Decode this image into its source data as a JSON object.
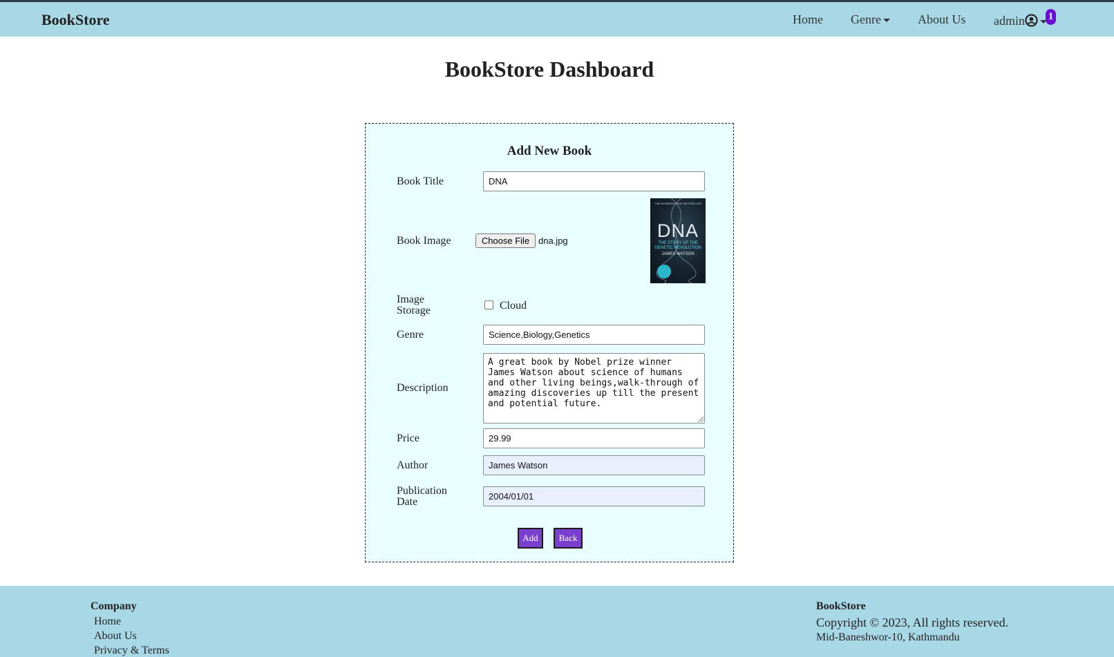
{
  "nav": {
    "brand": "BookStore",
    "links": {
      "home": "Home",
      "genre": "Genre",
      "about": "About Us",
      "user": "admin"
    },
    "notification_count": "1"
  },
  "page": {
    "title": "BookStore Dashboard"
  },
  "form": {
    "heading": "Add New Book",
    "labels": {
      "title": "Book Title",
      "image": "Book Image",
      "storage": "Image Storage",
      "genre": "Genre",
      "description": "Description",
      "price": "Price",
      "author": "Author",
      "date": "Publication Date"
    },
    "values": {
      "title": "DNA",
      "file_button": "Choose File",
      "file_name": "dna.jpg",
      "storage_option": "Cloud",
      "storage_checked": false,
      "genre": "Science,Biology,Genetics",
      "description": "A great book by Nobel prize winner James Watson about science of humans and other living beings,walk-through of amazing discoveries up till the present and potential future.",
      "price": "29.99",
      "author": "James Watson",
      "date": "2004/01/01"
    },
    "cover": {
      "top": "THE INTERNATIONAL BESTSELLER",
      "title": "DNA",
      "subtitle": "THE STORY OF THE GENETIC REVOLUTION",
      "author": "JAMES WATSON"
    },
    "buttons": {
      "add": "Add",
      "back": "Back"
    }
  },
  "footer": {
    "company_heading": "Company",
    "links": [
      "Home",
      "About Us",
      "Privacy & Terms"
    ],
    "brand": "BookStore",
    "copyright": "Copyright © 2023, All rights reserved.",
    "address": "Mid-Baneshwor-10, Kathmandu"
  },
  "colors": {
    "navbar": "#a8d8e6",
    "form_bg": "#e9fefe",
    "button": "#7b3fcf",
    "badge": "#6a0dd6"
  }
}
